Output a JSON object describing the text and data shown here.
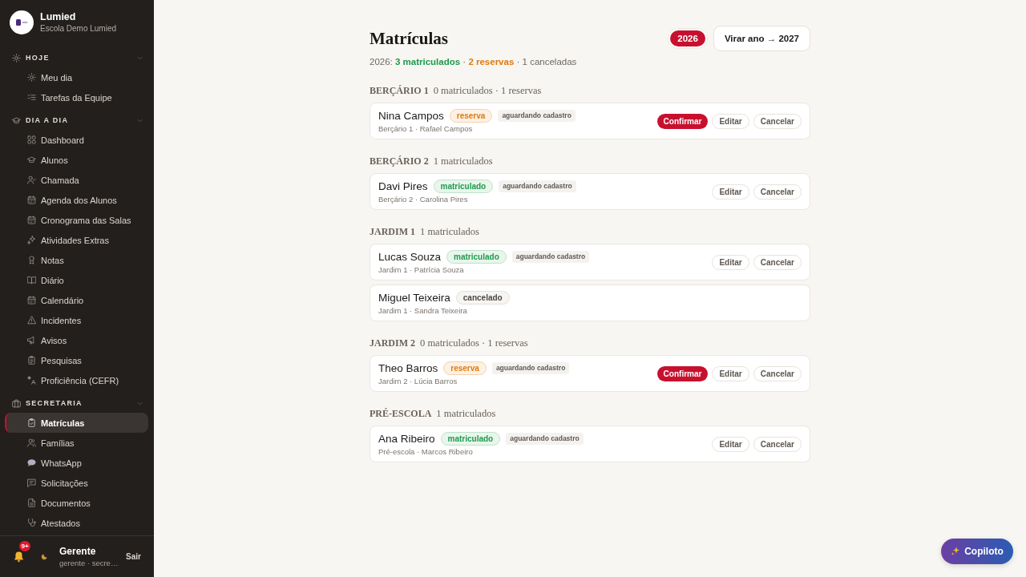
{
  "sidebar": {
    "brand": {
      "name": "Lumied",
      "school": "Escola Demo Lumied"
    },
    "sections": [
      {
        "title": "HOJE",
        "expanded": true,
        "items": [
          {
            "label": "Meu dia",
            "selected": false
          },
          {
            "label": "Tarefas da Equipe",
            "selected": false
          }
        ]
      },
      {
        "title": "DIA A DIA",
        "expanded": true,
        "items": [
          {
            "label": "Dashboard",
            "selected": false
          },
          {
            "label": "Alunos",
            "selected": false
          },
          {
            "label": "Chamada",
            "selected": false
          },
          {
            "label": "Agenda dos Alunos",
            "selected": false
          },
          {
            "label": "Cronograma das Salas",
            "selected": false
          },
          {
            "label": "Atividades Extras",
            "selected": false
          },
          {
            "label": "Notas",
            "selected": false
          },
          {
            "label": "Diário",
            "selected": false
          },
          {
            "label": "Calendário",
            "selected": false
          },
          {
            "label": "Incidentes",
            "selected": false
          },
          {
            "label": "Avisos",
            "selected": false
          },
          {
            "label": "Pesquisas",
            "selected": false
          },
          {
            "label": "Proficiência (CEFR)",
            "selected": false
          }
        ]
      },
      {
        "title": "SECRETARIA",
        "expanded": true,
        "items": [
          {
            "label": "Matrículas",
            "selected": true
          },
          {
            "label": "Famílias",
            "selected": false
          },
          {
            "label": "WhatsApp",
            "selected": false
          },
          {
            "label": "Solicitações",
            "selected": false
          },
          {
            "label": "Documentos",
            "selected": false
          },
          {
            "label": "Atestados",
            "selected": false
          }
        ]
      }
    ],
    "user": {
      "notifications": "9+",
      "name": "Gerente",
      "role": "gerente · secre…",
      "logout": "Sair"
    }
  },
  "page": {
    "title": "Matrículas",
    "years": [
      {
        "label": "2026",
        "selected": true
      }
    ],
    "turn_year": "Virar ano → 2027",
    "summary": {
      "year": "2026:",
      "separator": "·",
      "counts": [
        {
          "text": "3 matriculados",
          "kind": "enrolled"
        },
        {
          "text": "2 reservas",
          "kind": "reserved"
        },
        {
          "text": "1 canceladas",
          "kind": "cancelled"
        }
      ]
    }
  },
  "groups": [
    {
      "title": "BERÇÁRIO 1",
      "count": "0 matriculados · 1 reservas",
      "enrollments": [
        {
          "name": "Nina Campos",
          "status": {
            "label": "reserva",
            "kind": "reserved"
          },
          "tag": "aguardando cadastro",
          "detail": "Berçário 1 · Rafael Campos",
          "actions": [
            {
              "label": "Confirmar",
              "kind": "confirm"
            },
            {
              "label": "Editar",
              "kind": "edit"
            },
            {
              "label": "Cancelar",
              "kind": "cancel"
            }
          ]
        }
      ]
    },
    {
      "title": "BERÇÁRIO 2",
      "count": "1 matriculados",
      "enrollments": [
        {
          "name": "Davi Pires",
          "status": {
            "label": "matriculado",
            "kind": "enrolled"
          },
          "tag": "aguardando cadastro",
          "detail": "Berçário 2 · Carolina Pires",
          "actions": [
            {
              "label": "Editar",
              "kind": "edit"
            },
            {
              "label": "Cancelar",
              "kind": "cancel"
            }
          ]
        }
      ]
    },
    {
      "title": "JARDIM 1",
      "count": "1 matriculados",
      "enrollments": [
        {
          "name": "Lucas Souza",
          "status": {
            "label": "matriculado",
            "kind": "enrolled"
          },
          "tag": "aguardando cadastro",
          "detail": "Jardim 1 · Patrícia Souza",
          "actions": [
            {
              "label": "Editar",
              "kind": "edit"
            },
            {
              "label": "Cancelar",
              "kind": "cancel"
            }
          ]
        },
        {
          "name": "Miguel Teixeira",
          "status": {
            "label": "cancelado",
            "kind": "cancelled"
          },
          "detail": "Jardim 1 · Sandra Teixeira"
        }
      ]
    },
    {
      "title": "JARDIM 2",
      "count": "0 matriculados · 1 reservas",
      "enrollments": [
        {
          "name": "Theo Barros",
          "status": {
            "label": "reserva",
            "kind": "reserved"
          },
          "tag": "aguardando cadastro",
          "detail": "Jardim 2 · Lúcia Barros",
          "actions": [
            {
              "label": "Confirmar",
              "kind": "confirm"
            },
            {
              "label": "Editar",
              "kind": "edit"
            },
            {
              "label": "Cancelar",
              "kind": "cancel"
            }
          ]
        }
      ]
    },
    {
      "title": "PRÉ-ESCOLA",
      "count": "1 matriculados",
      "enrollments": [
        {
          "name": "Ana Ribeiro",
          "status": {
            "label": "matriculado",
            "kind": "enrolled"
          },
          "tag": "aguardando cadastro",
          "detail": "Pré-escola · Marcos Ribeiro",
          "actions": [
            {
              "label": "Editar",
              "kind": "edit"
            },
            {
              "label": "Cancelar",
              "kind": "cancel"
            }
          ]
        }
      ]
    }
  ],
  "copilot": {
    "label": "Copiloto"
  }
}
